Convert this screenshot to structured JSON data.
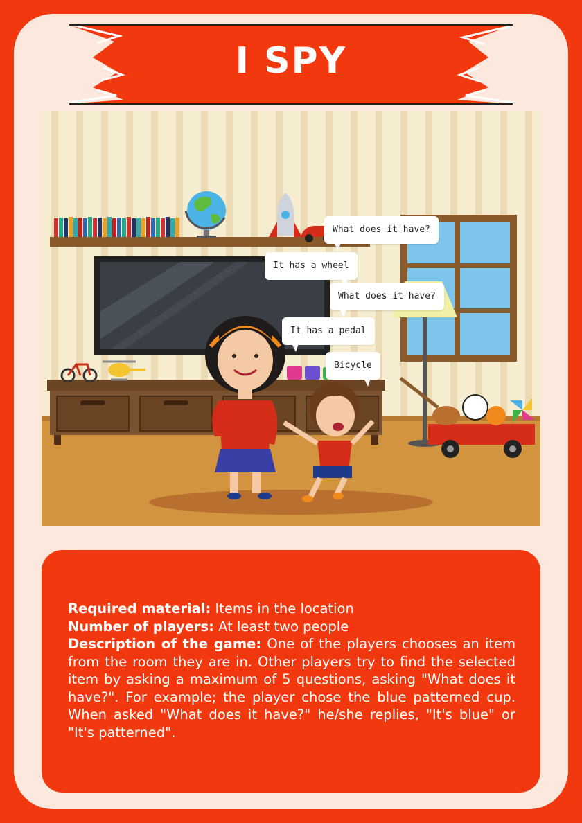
{
  "card": {
    "title": "I SPY"
  },
  "scene": {
    "bubbles": [
      "What does it have?",
      "It has a wheel",
      "What does it have?",
      "It has a pedal",
      "Bicycle"
    ]
  },
  "info": {
    "material_label": "Required material:",
    "material_value": "Items in the location",
    "players_label": "Number of players:",
    "players_value": "At least two people",
    "description_label": "Description of the game:",
    "description_value": "One of the players chooses an item from the room they are in. Other players try to find the selected item by asking a maximum of 5 questions, asking \"What does it have?\". For example; the player chose the blue patterned cup. When asked \"What does it have?\" he/she replies, \"It's blue\" or \"It's patterned\"."
  },
  "colors": {
    "background": "#f2380f",
    "card": "#fde8dd",
    "banner": "#f2380f",
    "text": "#ffffff"
  },
  "icons": [
    "globe-icon",
    "rocket-icon",
    "toy-car-icon",
    "bicycle-icon",
    "helicopter-icon",
    "toy-train-icon",
    "guitar-icon",
    "soccer-ball-icon",
    "pinwheel-icon",
    "wagon-icon"
  ]
}
